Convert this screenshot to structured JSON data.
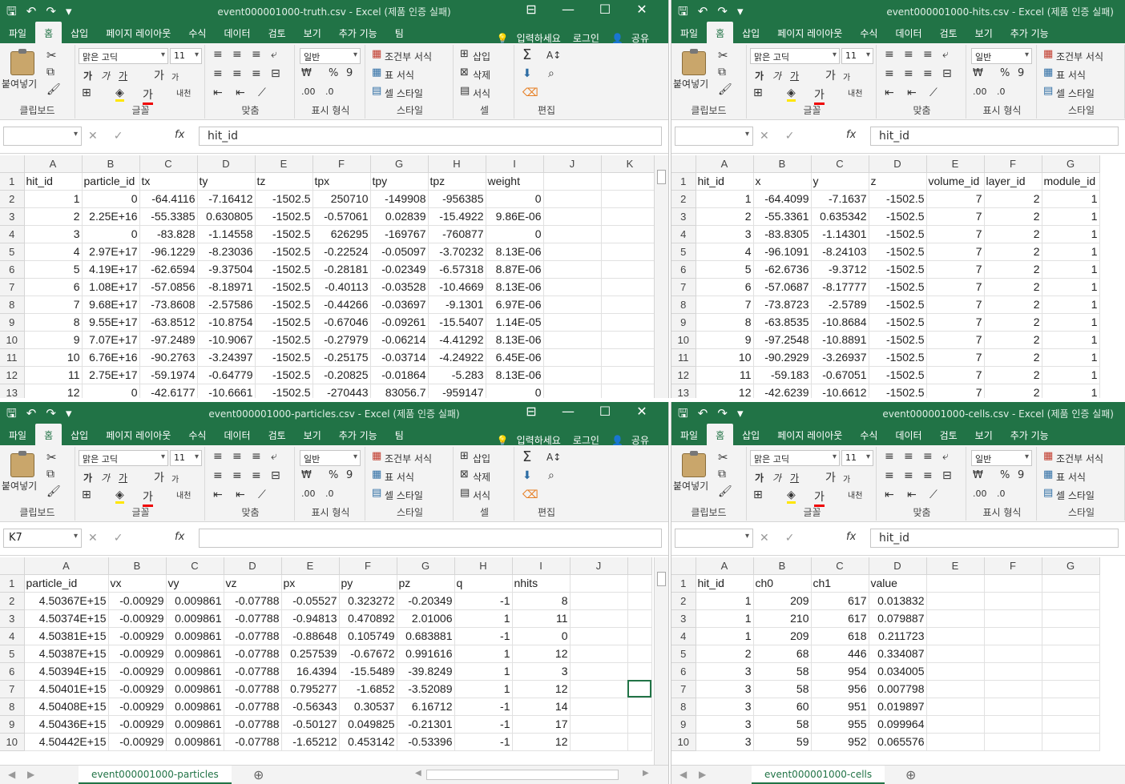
{
  "app": {
    "ribbon_tabs": [
      "파일",
      "홈",
      "삽입",
      "페이지 레이아웃",
      "수식",
      "데이터",
      "검토",
      "보기",
      "추가 기능",
      "팀"
    ],
    "tell_me": "입력하세요",
    "login": "로그인",
    "share": "공유"
  },
  "ribbon": {
    "paste": "붙여넣기",
    "clipboard": "클립보드",
    "font_group": "글꼴",
    "font_name": "맑은 고딕",
    "font_size": "11",
    "align_group": "맞춤",
    "number_group": "표시 형식",
    "number_format": "일반",
    "style_group": "스타일",
    "cond_format": "조건부 서식",
    "table_format": "표 서식",
    "cell_style": "셀 스타일",
    "cells_group": "셀",
    "insert": "삽입",
    "delete": "삭제",
    "format": "서식",
    "edit_group": "편집"
  },
  "windows": [
    {
      "id": "truth",
      "title": "event000001000-truth.csv - Excel (제품 인증 실패)",
      "namebox": "",
      "formula": "hit_id",
      "cols": [
        "A",
        "B",
        "C",
        "D",
        "E",
        "F",
        "G",
        "H",
        "I",
        "J",
        "K"
      ],
      "rows": [
        [
          "hit_id",
          "particle_id",
          "tx",
          "ty",
          "tz",
          "tpx",
          "tpy",
          "tpz",
          "weight",
          "",
          ""
        ],
        [
          "1",
          "0",
          "-64.4116",
          "-7.16412",
          "-1502.5",
          "250710",
          "-149908",
          "-956385",
          "0",
          "",
          ""
        ],
        [
          "2",
          "2.25E+16",
          "-55.3385",
          "0.630805",
          "-1502.5",
          "-0.57061",
          "0.02839",
          "-15.4922",
          "9.86E-06",
          "",
          ""
        ],
        [
          "3",
          "0",
          "-83.828",
          "-1.14558",
          "-1502.5",
          "626295",
          "-169767",
          "-760877",
          "0",
          "",
          ""
        ],
        [
          "4",
          "2.97E+17",
          "-96.1229",
          "-8.23036",
          "-1502.5",
          "-0.22524",
          "-0.05097",
          "-3.70232",
          "8.13E-06",
          "",
          ""
        ],
        [
          "5",
          "4.19E+17",
          "-62.6594",
          "-9.37504",
          "-1502.5",
          "-0.28181",
          "-0.02349",
          "-6.57318",
          "8.87E-06",
          "",
          ""
        ],
        [
          "6",
          "1.08E+17",
          "-57.0856",
          "-8.18971",
          "-1502.5",
          "-0.40113",
          "-0.03528",
          "-10.4669",
          "8.13E-06",
          "",
          ""
        ],
        [
          "7",
          "9.68E+17",
          "-73.8608",
          "-2.57586",
          "-1502.5",
          "-0.44266",
          "-0.03697",
          "-9.1301",
          "6.97E-06",
          "",
          ""
        ],
        [
          "8",
          "9.55E+17",
          "-63.8512",
          "-10.8754",
          "-1502.5",
          "-0.67046",
          "-0.09261",
          "-15.5407",
          "1.14E-05",
          "",
          ""
        ],
        [
          "9",
          "7.07E+17",
          "-97.2489",
          "-10.9067",
          "-1502.5",
          "-0.27979",
          "-0.06214",
          "-4.41292",
          "8.13E-06",
          "",
          ""
        ],
        [
          "10",
          "6.76E+16",
          "-90.2763",
          "-3.24397",
          "-1502.5",
          "-0.25175",
          "-0.03714",
          "-4.24922",
          "6.45E-06",
          "",
          ""
        ],
        [
          "11",
          "2.75E+17",
          "-59.1974",
          "-0.64779",
          "-1502.5",
          "-0.20825",
          "-0.01864",
          "-5.283",
          "8.13E-06",
          "",
          ""
        ],
        [
          "12",
          "0",
          "-42.6177",
          "-10.6661",
          "-1502.5",
          "-270443",
          "83056.7",
          "-959147",
          "0",
          "",
          ""
        ]
      ]
    },
    {
      "id": "hits",
      "title": "event000001000-hits.csv - Excel (제품 인증 실패)",
      "namebox": "",
      "formula": "hit_id",
      "cols": [
        "A",
        "B",
        "C",
        "D",
        "E",
        "F",
        "G"
      ],
      "rows": [
        [
          "hit_id",
          "x",
          "y",
          "z",
          "volume_id",
          "layer_id",
          "module_id"
        ],
        [
          "1",
          "-64.4099",
          "-7.1637",
          "-1502.5",
          "7",
          "2",
          "1"
        ],
        [
          "2",
          "-55.3361",
          "0.635342",
          "-1502.5",
          "7",
          "2",
          "1"
        ],
        [
          "3",
          "-83.8305",
          "-1.14301",
          "-1502.5",
          "7",
          "2",
          "1"
        ],
        [
          "4",
          "-96.1091",
          "-8.24103",
          "-1502.5",
          "7",
          "2",
          "1"
        ],
        [
          "5",
          "-62.6736",
          "-9.3712",
          "-1502.5",
          "7",
          "2",
          "1"
        ],
        [
          "6",
          "-57.0687",
          "-8.17777",
          "-1502.5",
          "7",
          "2",
          "1"
        ],
        [
          "7",
          "-73.8723",
          "-2.5789",
          "-1502.5",
          "7",
          "2",
          "1"
        ],
        [
          "8",
          "-63.8535",
          "-10.8684",
          "-1502.5",
          "7",
          "2",
          "1"
        ],
        [
          "9",
          "-97.2548",
          "-10.8891",
          "-1502.5",
          "7",
          "2",
          "1"
        ],
        [
          "10",
          "-90.2929",
          "-3.26937",
          "-1502.5",
          "7",
          "2",
          "1"
        ],
        [
          "11",
          "-59.183",
          "-0.67051",
          "-1502.5",
          "7",
          "2",
          "1"
        ],
        [
          "12",
          "-42.6239",
          "-10.6612",
          "-1502.5",
          "7",
          "2",
          "1"
        ]
      ]
    },
    {
      "id": "particles",
      "title": "event000001000-particles.csv - Excel (제품 인증 실패)",
      "namebox": "K7",
      "formula": "",
      "sheet_tab": "event000001000-particles",
      "cols": [
        "A",
        "B",
        "C",
        "D",
        "E",
        "F",
        "G",
        "H",
        "I",
        "J",
        ""
      ],
      "rows": [
        [
          "particle_id",
          "vx",
          "vy",
          "vz",
          "px",
          "py",
          "pz",
          "q",
          "nhits",
          "",
          ""
        ],
        [
          "4.50367E+15",
          "-0.00929",
          "0.009861",
          "-0.07788",
          "-0.05527",
          "0.323272",
          "-0.20349",
          "-1",
          "8",
          "",
          ""
        ],
        [
          "4.50374E+15",
          "-0.00929",
          "0.009861",
          "-0.07788",
          "-0.94813",
          "0.470892",
          "2.01006",
          "1",
          "11",
          "",
          ""
        ],
        [
          "4.50381E+15",
          "-0.00929",
          "0.009861",
          "-0.07788",
          "-0.88648",
          "0.105749",
          "0.683881",
          "-1",
          "0",
          "",
          ""
        ],
        [
          "4.50387E+15",
          "-0.00929",
          "0.009861",
          "-0.07788",
          "0.257539",
          "-0.67672",
          "0.991616",
          "1",
          "12",
          "",
          ""
        ],
        [
          "4.50394E+15",
          "-0.00929",
          "0.009861",
          "-0.07788",
          "16.4394",
          "-15.5489",
          "-39.8249",
          "1",
          "3",
          "",
          ""
        ],
        [
          "4.50401E+15",
          "-0.00929",
          "0.009861",
          "-0.07788",
          "0.795277",
          "-1.6852",
          "-3.52089",
          "1",
          "12",
          "",
          ""
        ],
        [
          "4.50408E+15",
          "-0.00929",
          "0.009861",
          "-0.07788",
          "-0.56343",
          "0.30537",
          "6.16712",
          "-1",
          "14",
          "",
          ""
        ],
        [
          "4.50436E+15",
          "-0.00929",
          "0.009861",
          "-0.07788",
          "-0.50127",
          "0.049825",
          "-0.21301",
          "-1",
          "17",
          "",
          ""
        ],
        [
          "4.50442E+15",
          "-0.00929",
          "0.009861",
          "-0.07788",
          "-1.65212",
          "0.453142",
          "-0.53396",
          "-1",
          "12",
          "",
          ""
        ]
      ]
    },
    {
      "id": "cells",
      "title": "event000001000-cells.csv - Excel (제품 인증 실패)",
      "namebox": "",
      "formula": "hit_id",
      "sheet_tab": "event000001000-cells",
      "cols": [
        "A",
        "B",
        "C",
        "D",
        "E",
        "F",
        "G"
      ],
      "rows": [
        [
          "hit_id",
          "ch0",
          "ch1",
          "value",
          "",
          "",
          ""
        ],
        [
          "1",
          "209",
          "617",
          "0.013832",
          "",
          "",
          ""
        ],
        [
          "1",
          "210",
          "617",
          "0.079887",
          "",
          "",
          ""
        ],
        [
          "1",
          "209",
          "618",
          "0.211723",
          "",
          "",
          ""
        ],
        [
          "2",
          "68",
          "446",
          "0.334087",
          "",
          "",
          ""
        ],
        [
          "3",
          "58",
          "954",
          "0.034005",
          "",
          "",
          ""
        ],
        [
          "3",
          "58",
          "956",
          "0.007798",
          "",
          "",
          ""
        ],
        [
          "3",
          "60",
          "951",
          "0.019897",
          "",
          "",
          ""
        ],
        [
          "3",
          "58",
          "955",
          "0.099964",
          "",
          "",
          ""
        ],
        [
          "3",
          "59",
          "952",
          "0.065576",
          "",
          "",
          ""
        ]
      ]
    }
  ]
}
